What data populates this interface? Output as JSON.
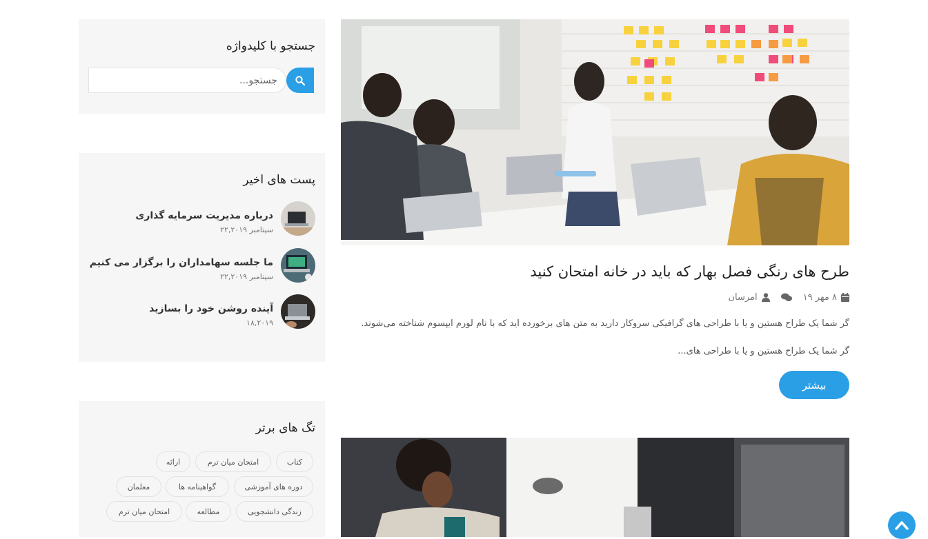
{
  "post": {
    "title": "طرح های رنگی فصل بهار که باید در خانه امتحان کنید",
    "date": "۸ مهر ۱۹",
    "author": "امرسان",
    "excerpt_line1": "گر شما یک طراح هستین و یا با طراحی های گرافیکی سروکار دارید به متن های برخورده اید که با نام لورم ایپسوم شناخته می‌شوند.",
    "excerpt_line2": "گر شما یک طراح هستین و یا با طراحی های...",
    "more_label": "بیشتر"
  },
  "sidebar": {
    "search": {
      "title": "جستجو با کلیدواژه",
      "placeholder": "جستجو..."
    },
    "recent": {
      "title": "پست های اخیر",
      "items": [
        {
          "title": "درباره مدیریت سرمایه گذاری",
          "date": "سپتامبر ۲۲,۲۰۱۹"
        },
        {
          "title": "ما جلسه سهامداران را برگزار می کنیم",
          "date": "سپتامبر ۲۲,۲۰۱۹"
        },
        {
          "title": "آینده روشن خود را بسازید",
          "date": "۱۸,۲۰۱۹"
        }
      ]
    },
    "tags": {
      "title": "تگ های برتر",
      "items": [
        "کتاب",
        "امتحان میان ترم",
        "ارائه",
        "دوره های آموزشی",
        "گواهینامه ها",
        "معلمان",
        "زندگی دانشجویی",
        "مطالعه",
        "امتحان میان ترم"
      ]
    }
  },
  "colors": {
    "accent": "#2b9fe6",
    "widget_bg": "#f6f6f6"
  },
  "icons": {
    "search": "search-icon",
    "calendar": "calendar-icon",
    "comments": "comments-icon",
    "user": "user-icon",
    "scroll_top": "chevron-up-icon"
  }
}
